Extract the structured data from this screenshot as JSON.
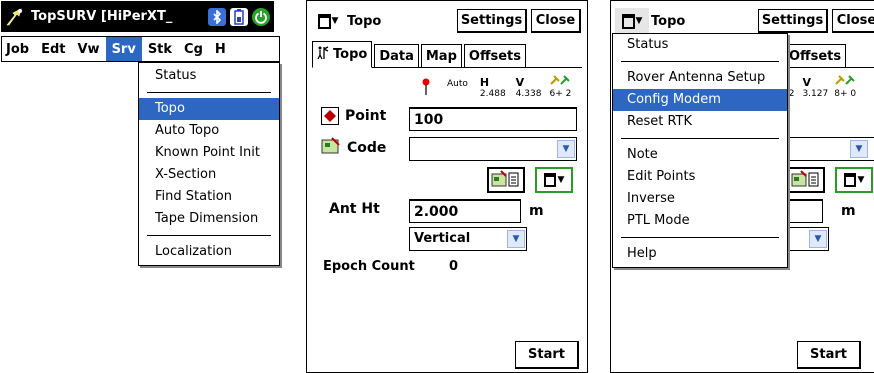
{
  "panel1": {
    "title": "TopSURV [HiPerXT_",
    "menubar": [
      "Job",
      "Edt",
      "Vw",
      "Srv",
      "Stk",
      "Cg",
      "H"
    ],
    "menu_items": [
      {
        "label": "Status",
        "sep_after": true
      },
      {
        "label": "Topo",
        "selected": true
      },
      {
        "label": "Auto Topo"
      },
      {
        "label": "Known Point Init"
      },
      {
        "label": "X-Section"
      },
      {
        "label": "Find Station"
      },
      {
        "label": "Tape Dimension",
        "sep_after": true
      },
      {
        "label": "Localization"
      }
    ]
  },
  "panel2": {
    "title": "Topo",
    "settings_label": "Settings",
    "close_label": "Close",
    "tabs": [
      "Topo",
      "Data",
      "Map",
      "Offsets"
    ],
    "status": {
      "mode": "Auto",
      "h_label": "H",
      "h_value": "2.488",
      "v_label": "V",
      "v_value": "4.338",
      "sat": "6+ 2"
    },
    "point_label": "Point",
    "point_value": "100",
    "code_label": "Code",
    "code_value": "",
    "ant_ht_label": "Ant Ht",
    "ant_ht_value": "2.000",
    "ant_ht_unit": "m",
    "ant_ht_type": "Vertical",
    "epoch_label": "Epoch Count",
    "epoch_value": "0",
    "start_label": "Start"
  },
  "panel3": {
    "title": "Topo",
    "settings_label": "Settings",
    "close_label": "Close",
    "tabs_visible": [
      "Offsets"
    ],
    "status": {
      "v_label": "V",
      "h_value_partial": "02",
      "v_value": "3.127",
      "sat": "8+ 0"
    },
    "ant_ht_unit": "m",
    "start_label": "Start",
    "menu_items": [
      {
        "label": "Status",
        "sep_after": true
      },
      {
        "label": "Rover Antenna Setup"
      },
      {
        "label": "Config Modem",
        "selected": true
      },
      {
        "label": "Reset RTK",
        "sep_after": true
      },
      {
        "label": "Note"
      },
      {
        "label": "Edit Points"
      },
      {
        "label": "Inverse"
      },
      {
        "label": "PTL Mode",
        "sep_after": true
      },
      {
        "label": "Help"
      }
    ]
  },
  "colors": {
    "selection": "#2d67c2",
    "titlebar": "#000000",
    "dropdown_button": "#dfe9fa"
  }
}
